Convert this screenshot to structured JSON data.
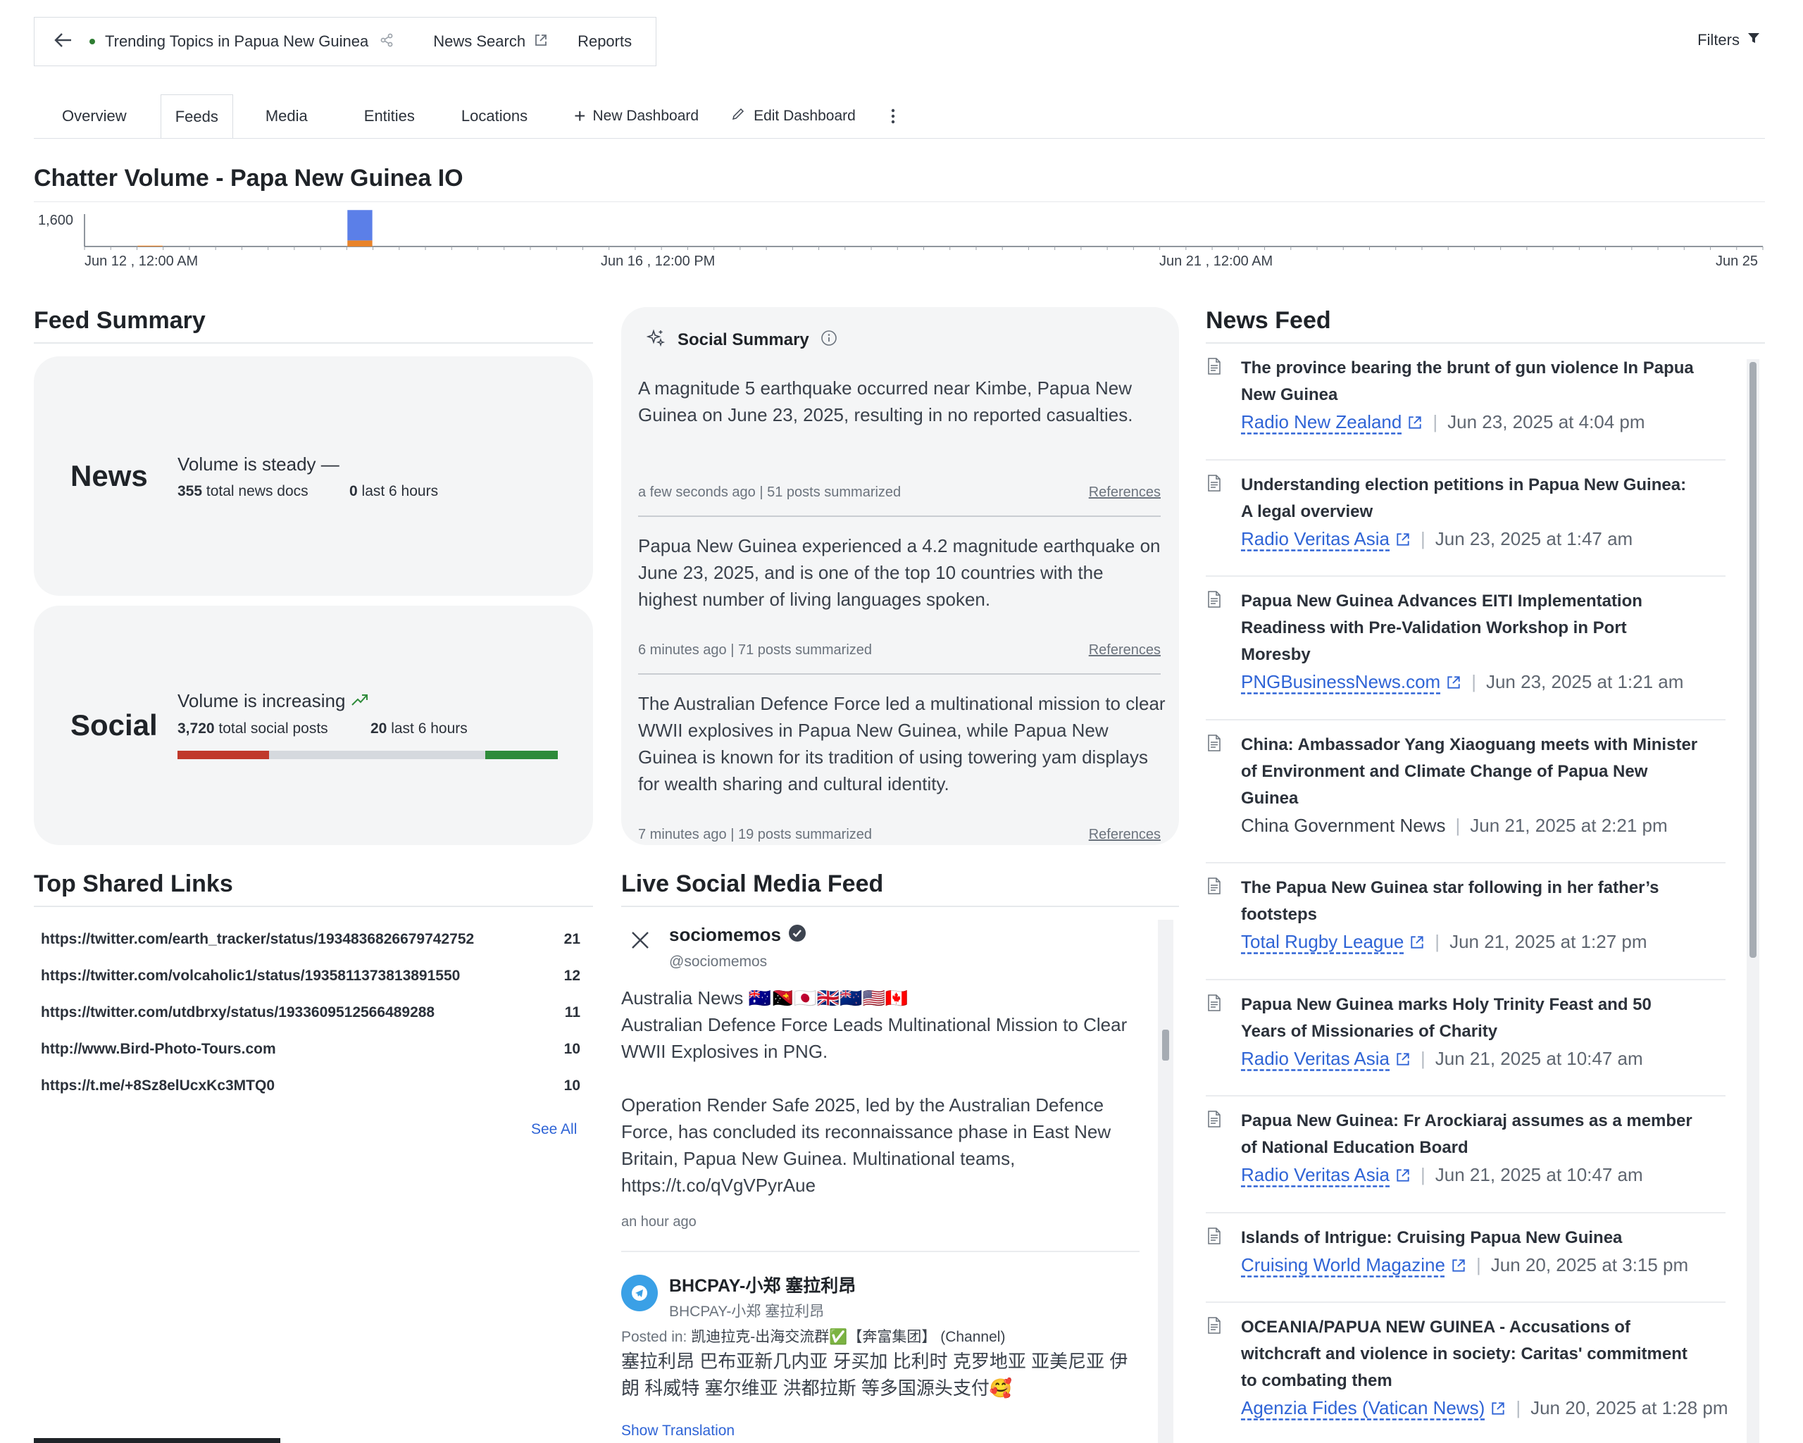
{
  "header": {
    "back_icon": "arrow-left-icon",
    "breadcrumb_title": "Trending Topics in Papua New Guinea",
    "share_icon": "share-icon",
    "news_search": "News Search",
    "reports": "Reports",
    "filters": "Filters"
  },
  "tabs": {
    "overview": "Overview",
    "feeds": "Feeds",
    "media": "Media",
    "entities": "Entities",
    "locations": "Locations",
    "new_dashboard": "New Dashboard",
    "edit_dashboard": "Edit Dashboard"
  },
  "chatter": {
    "title": "Chatter Volume - Papa New Guinea IO"
  },
  "chart_data": {
    "type": "bar",
    "title": "Chatter Volume - Papa New Guinea IO",
    "ytick": "1,600",
    "xticks": [
      "Jun 12 , 12:00 AM",
      "Jun 16 , 12:00 PM",
      "Jun 21 , 12:00 AM",
      "Jun 25"
    ],
    "ylim": [
      0,
      1600
    ],
    "grid": false,
    "series": [
      {
        "color": "#5b7fe8",
        "values": [
          0,
          0,
          0,
          0,
          0,
          0,
          0,
          0,
          0,
          0,
          1500,
          0,
          0,
          0,
          0,
          0,
          0,
          0,
          0,
          0,
          0,
          0,
          0,
          0,
          0,
          0,
          0,
          0,
          0,
          0,
          0,
          0,
          0,
          0,
          0,
          0,
          0,
          0,
          0,
          0,
          0,
          0,
          0,
          0,
          0,
          0,
          0,
          0,
          0,
          0,
          0,
          0,
          0,
          0,
          0,
          0,
          0,
          0,
          0,
          0,
          0,
          0,
          0,
          0
        ]
      },
      {
        "color": "#e8832a",
        "values": [
          0,
          0,
          40,
          0,
          0,
          0,
          0,
          0,
          0,
          0,
          300,
          0,
          0,
          0,
          0,
          0,
          0,
          0,
          0,
          0,
          0,
          0,
          0,
          0,
          0,
          0,
          0,
          0,
          0,
          0,
          0,
          0,
          0,
          0,
          0,
          0,
          0,
          0,
          0,
          0,
          0,
          0,
          0,
          0,
          0,
          0,
          0,
          0,
          0,
          0,
          0,
          0,
          0,
          0,
          0,
          0,
          0,
          0,
          0,
          0,
          0,
          0,
          0,
          0
        ]
      }
    ]
  },
  "feed_summary": {
    "title": "Feed Summary",
    "news": {
      "label": "News",
      "volume": "Volume is steady",
      "total_count": "355",
      "total_label": "total news docs",
      "recent_count": "0",
      "recent_label": "last 6 hours"
    },
    "social": {
      "label": "Social",
      "volume": "Volume is increasing",
      "total_count": "3,720",
      "total_label": "total social posts",
      "recent_count": "20",
      "recent_label": "last 6 hours",
      "sentiment": {
        "negative": 0.24,
        "neutral": 0.57,
        "positive": 0.19
      }
    }
  },
  "social_summary": {
    "title": "Social Summary",
    "items": [
      {
        "text": "A magnitude 5 earthquake occurred near Kimbe, Papua New Guinea on June 23, 2025, resulting in no reported casualties.",
        "meta": "a few seconds ago | 51 posts summarized",
        "ref": "References"
      },
      {
        "text": "Papua New Guinea experienced a 4.2 magnitude earthquake on June 23, 2025, and is one of the top 10 countries with the highest number of living languages spoken.",
        "meta": "6 minutes ago | 71 posts summarized",
        "ref": "References"
      },
      {
        "text": "The Australian Defence Force led a multinational mission to clear WWII explosives in Papua New Guinea, while Papua New Guinea is known for its tradition of using towering yam displays for wealth sharing and cultural identity.",
        "meta": "7 minutes ago | 19 posts summarized",
        "ref": "References"
      }
    ]
  },
  "top_links": {
    "title": "Top Shared Links",
    "see_all": "See All",
    "rows": [
      {
        "url": "https://twitter.com/earth_tracker/status/1934836826679742752",
        "count": "21"
      },
      {
        "url": "https://twitter.com/volcaholic1/status/1935811373813891550",
        "count": "12"
      },
      {
        "url": "https://twitter.com/utdbrxy/status/1933609512566489288",
        "count": "11"
      },
      {
        "url": "http://www.Bird-Photo-Tours.com",
        "count": "10"
      },
      {
        "url": "https://t.me/+8Sz8elUcxKc3MTQ0",
        "count": "10"
      }
    ]
  },
  "live_feed": {
    "title": "Live Social Media Feed",
    "post1": {
      "name": "sociomemos",
      "handle": "@sociomemos",
      "line1": "Australia News 🇦🇺🇵🇬🇯🇵🇬🇧🇳🇿🇺🇸🇨🇦",
      "line2": "Australian Defence Force Leads Multinational Mission to Clear WWII Explosives in PNG.",
      "line3": "Operation Render Safe 2025, led by the Australian Defence Force, has concluded its reconnaissance phase in East New Britain, Papua New Guinea. Multinational teams, https://t.co/qVgVPyrAue",
      "time": "an hour ago"
    },
    "post2": {
      "name": "BHCPAY-小郑 塞拉利昂",
      "handle": "BHCPAY-小郑 塞拉利昂",
      "posted_in_label": "Posted in:",
      "posted_in": "凯迪拉克-出海交流群✅【奔富集团】 (Channel)",
      "text": "塞拉利昂 巴布亚新几内亚 牙买加 比利时 克罗地亚 亚美尼亚 伊朗 科威特 塞尔维亚 洪都拉斯 等多国源头支付🥰",
      "translate": "Show Translation"
    }
  },
  "news_feed": {
    "title": "News Feed",
    "items": [
      {
        "title_l1": "The province bearing the brunt of gun violence In Papua",
        "title_l2": "New Guinea",
        "title_l3": "",
        "source": "Radio New Zealand",
        "date": "Jun 23, 2025 at 4:04 pm"
      },
      {
        "title_l1": "Understanding election petitions in Papua New Guinea:",
        "title_l2": "A legal overview",
        "title_l3": "",
        "source": "Radio Veritas Asia",
        "date": "Jun 23, 2025 at 1:47 am"
      },
      {
        "title_l1": "Papua New Guinea Advances EITI Implementation",
        "title_l2": "Readiness with Pre-Validation Workshop in Port",
        "title_l3": "Moresby",
        "source": "PNGBusinessNews.com",
        "date": "Jun 23, 2025 at 1:21 am"
      },
      {
        "title_l1": "China: Ambassador Yang Xiaoguang meets with Minister",
        "title_l2": "of Environment and Climate Change of Papua New",
        "title_l3": "Guinea",
        "source": "China Government News",
        "date": "Jun 21, 2025 at 2:21 pm"
      },
      {
        "title_l1": "The Papua New Guinea star following in her father’s",
        "title_l2": "footsteps",
        "title_l3": "",
        "source": "Total Rugby League",
        "date": "Jun 21, 2025 at 1:27 pm"
      },
      {
        "title_l1": "Papua New Guinea marks Holy Trinity Feast and 50",
        "title_l2": "Years of Missionaries of Charity",
        "title_l3": "",
        "source": "Radio Veritas Asia",
        "date": "Jun 21, 2025 at 10:47 am"
      },
      {
        "title_l1": "Papua New Guinea: Fr Arockiaraj assumes as a member",
        "title_l2": "of National Education Board",
        "title_l3": "",
        "source": "Radio Veritas Asia",
        "date": "Jun 21, 2025 at 10:47 am"
      },
      {
        "title_l1": "Islands of Intrigue: Cruising Papua New Guinea",
        "title_l2": "",
        "title_l3": "",
        "source": "Cruising World Magazine",
        "date": "Jun 20, 2025 at 3:15 pm"
      },
      {
        "title_l1": "OCEANIA/PAPUA NEW GUINEA - Accusations of",
        "title_l2": "witchcraft and violence in society: Caritas' commitment",
        "title_l3": "to combating them",
        "source": "Agenzia Fides (Vatican News)",
        "date": "Jun 20, 2025 at 1:28 pm"
      }
    ]
  },
  "colors": {
    "accent": "#2f64d6",
    "negative": "#c0392b",
    "neutral": "#d5d9de",
    "positive": "#2e8b3a",
    "bar_blue": "#5b7fe8",
    "bar_orange": "#e8832a"
  }
}
